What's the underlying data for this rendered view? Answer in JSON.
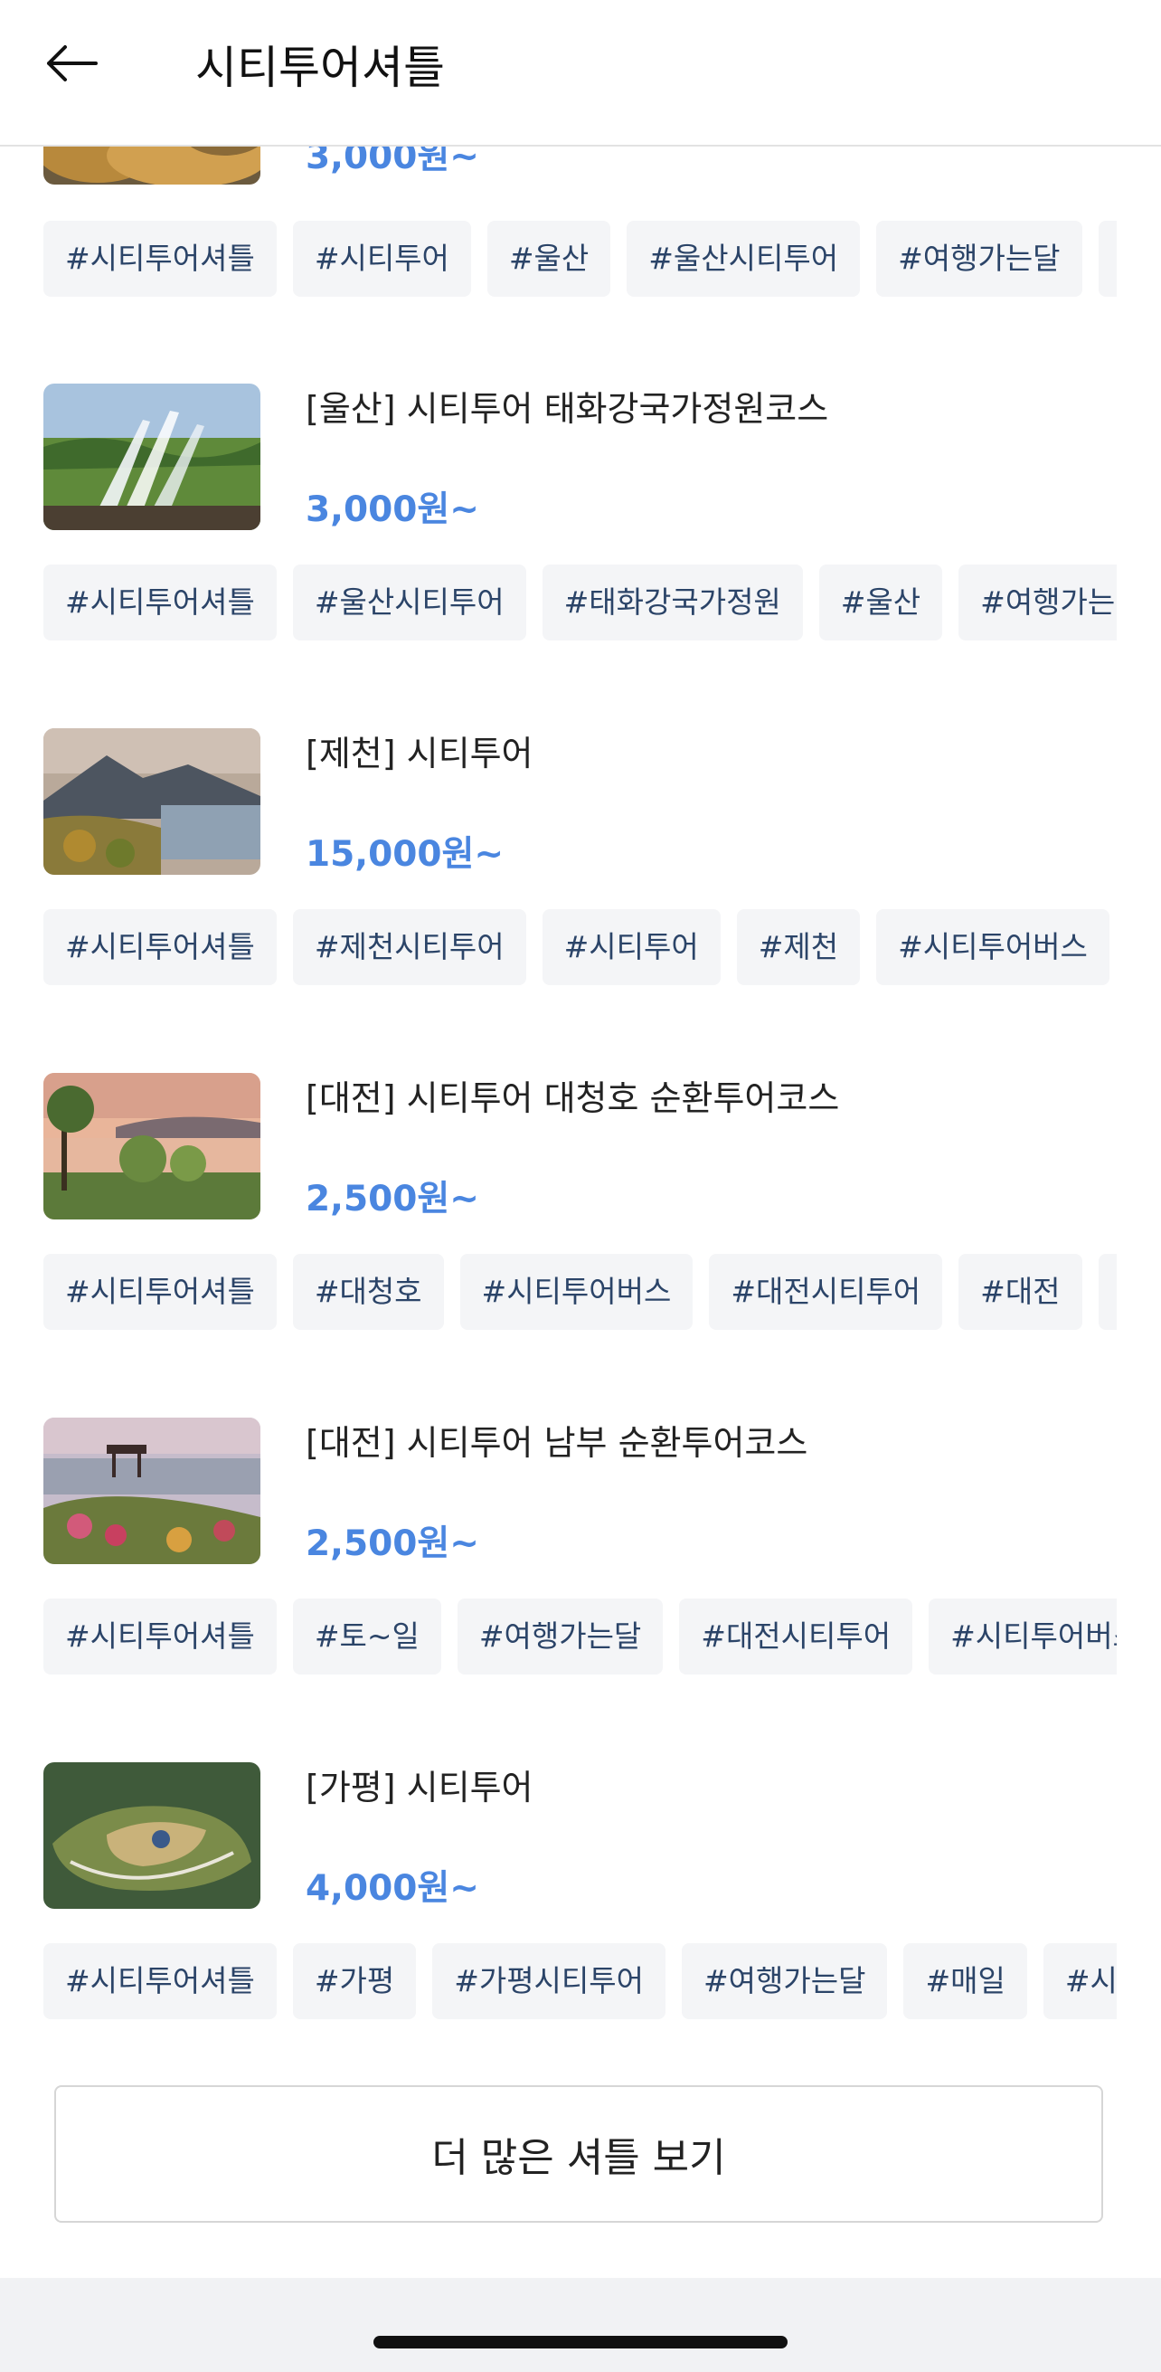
{
  "header": {
    "title": "시티투어셔틀"
  },
  "items": [
    {
      "title": "",
      "price": "3,000원~",
      "tags": [
        "#시티투어셔틀",
        "#시티투어",
        "#울산",
        "#울산시티투어",
        "#여행가는달",
        "#"
      ]
    },
    {
      "title": "[울산] 시티투어 태화강국가정원코스",
      "price": "3,000원~",
      "tags": [
        "#시티투어셔틀",
        "#울산시티투어",
        "#태화강국가정원",
        "#울산",
        "#여행가는달"
      ]
    },
    {
      "title": "[제천] 시티투어",
      "price": "15,000원~",
      "tags": [
        "#시티투어셔틀",
        "#제천시티투어",
        "#시티투어",
        "#제천",
        "#시티투어버스"
      ]
    },
    {
      "title": "[대전] 시티투어 대청호 순환투어코스",
      "price": "2,500원~",
      "tags": [
        "#시티투어셔틀",
        "#대청호",
        "#시티투어버스",
        "#대전시티투어",
        "#대전",
        "#"
      ]
    },
    {
      "title": "[대전] 시티투어 남부 순환투어코스",
      "price": "2,500원~",
      "tags": [
        "#시티투어셔틀",
        "#토~일",
        "#여행가는달",
        "#대전시티투어",
        "#시티투어버스"
      ]
    },
    {
      "title": "[가평] 시티투어",
      "price": "4,000원~",
      "tags": [
        "#시티투어셔틀",
        "#가평",
        "#가평시티투어",
        "#여행가는달",
        "#매일",
        "#시티"
      ]
    }
  ],
  "more_button": {
    "label": "더 많은 셔틀 보기"
  },
  "icons": {
    "back": "arrow-left-icon"
  },
  "colors": {
    "price": "#4a86e0",
    "tag_text": "#2b4468",
    "tag_bg": "#f4f5f7"
  }
}
